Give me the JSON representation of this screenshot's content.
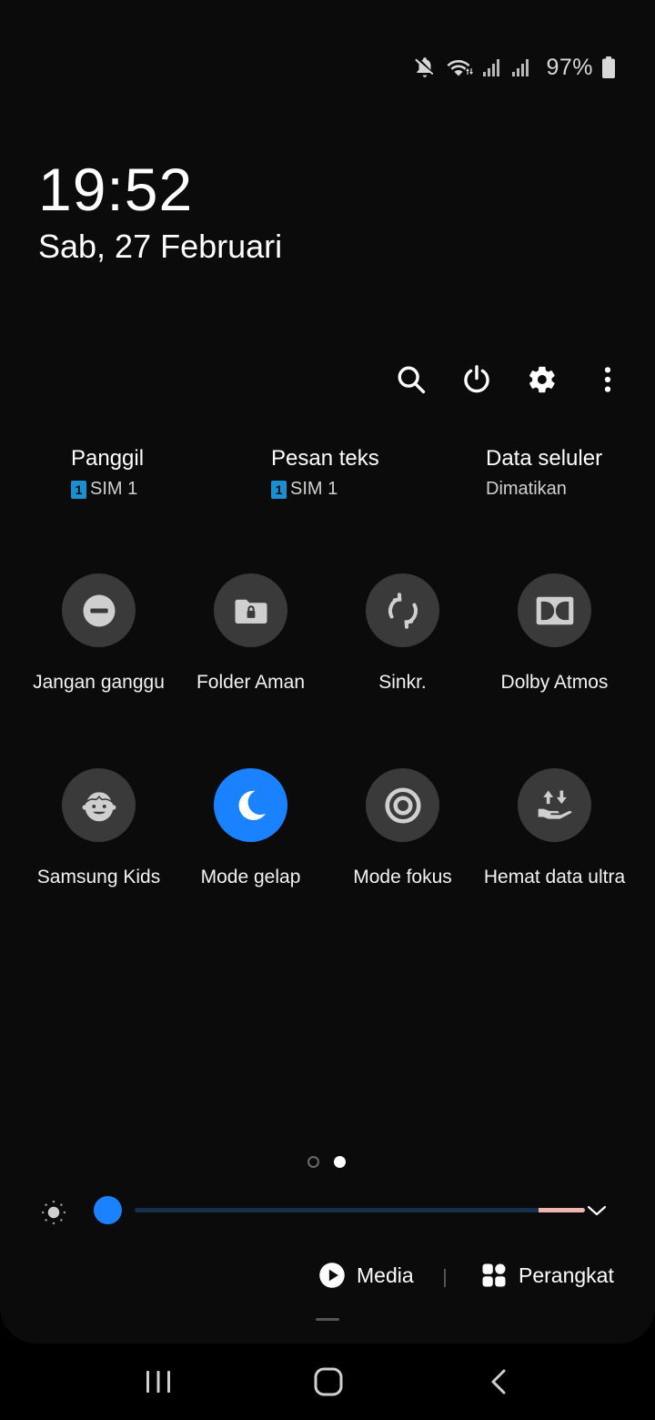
{
  "status_bar": {
    "battery_percent": "97%",
    "icons": [
      "mute-icon",
      "wifi-icon",
      "signal-sim1-icon",
      "signal-sim2-icon",
      "battery-icon"
    ]
  },
  "clock": {
    "time": "19:52",
    "date": "Sab, 27 Februari"
  },
  "top_actions": [
    "search-icon",
    "power-icon",
    "gear-icon",
    "more-vert-icon"
  ],
  "shortcuts": [
    {
      "title": "Panggil",
      "sub": "SIM 1",
      "sim_badge": "1"
    },
    {
      "title": "Pesan teks",
      "sub": "SIM 1",
      "sim_badge": "1"
    },
    {
      "title": "Data seluler",
      "sub": "Dimatikan"
    }
  ],
  "tiles": [
    {
      "label": "Jangan ganggu",
      "icon": "do-not-disturb-icon",
      "active": false
    },
    {
      "label": "Folder Aman",
      "icon": "secure-folder-icon",
      "active": false
    },
    {
      "label": "Sinkr.",
      "icon": "sync-icon",
      "active": false
    },
    {
      "label": "Dolby Atmos",
      "icon": "dolby-icon",
      "active": false
    },
    {
      "label": "Samsung Kids",
      "icon": "kids-icon",
      "active": false
    },
    {
      "label": "Mode gelap",
      "icon": "moon-icon",
      "active": true
    },
    {
      "label": "Mode fokus",
      "icon": "focus-icon",
      "active": false
    },
    {
      "label": "Hemat data ultra",
      "icon": "data-saver-icon",
      "active": false
    }
  ],
  "pager": {
    "pages": 2,
    "current": 2
  },
  "brightness": {
    "level": 0.03
  },
  "media_row": {
    "media_label": "Media",
    "devices_label": "Perangkat"
  },
  "colors": {
    "accent": "#1a82ff",
    "tile_off": "#3a3a3a",
    "panel_bg": "#0b0b0b"
  }
}
